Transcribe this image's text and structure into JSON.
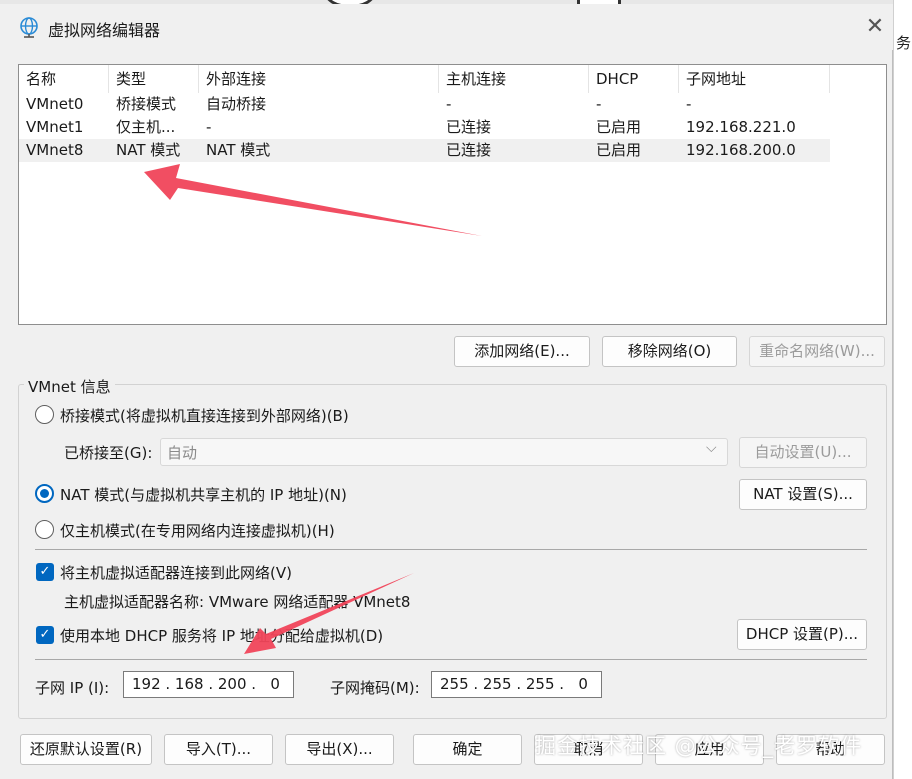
{
  "window": {
    "title": "虚拟网络编辑器",
    "close_glyph": "✕"
  },
  "background": {
    "right_text": "务"
  },
  "network_list": {
    "columns": [
      "名称",
      "类型",
      "外部连接",
      "主机连接",
      "DHCP",
      "子网地址"
    ],
    "rows": [
      {
        "name": "VMnet0",
        "type": "桥接模式",
        "external": "自动桥接",
        "host": "-",
        "dhcp": "-",
        "subnet": "-"
      },
      {
        "name": "VMnet1",
        "type": "仅主机...",
        "external": "-",
        "host": "已连接",
        "dhcp": "已启用",
        "subnet": "192.168.221.0"
      },
      {
        "name": "VMnet8",
        "type": "NAT 模式",
        "external": "NAT 模式",
        "host": "已连接",
        "dhcp": "已启用",
        "subnet": "192.168.200.0"
      }
    ],
    "selected_row": "VMnet8"
  },
  "list_buttons": {
    "add": "添加网络(E)...",
    "remove": "移除网络(O)",
    "rename": "重命名网络(W)..."
  },
  "vmnet_info": {
    "group_label": "VMnet 信息",
    "bridged_option": "桥接模式(将虚拟机直接连接到外部网络)(B)",
    "bridged_to_label": "已桥接至(G):",
    "bridged_to_value": "自动",
    "auto_settings": "自动设置(U)...",
    "nat_option": "NAT 模式(与虚拟机共享主机的 IP 地址)(N)",
    "nat_settings": "NAT 设置(S)...",
    "hostonly_option": "仅主机模式(在专用网络内连接虚拟机)(H)",
    "connect_adapter": "将主机虚拟适配器连接到此网络(V)",
    "adapter_name": "主机虚拟适配器名称: VMware 网络适配器 VMnet8",
    "use_dhcp": "使用本地 DHCP 服务将 IP 地址分配给虚拟机(D)",
    "dhcp_settings": "DHCP 设置(P)...",
    "subnet_ip_label": "子网 IP (I):",
    "subnet_ip_value": "192 . 168 . 200 .   0",
    "subnet_mask_label": "子网掩码(M):",
    "subnet_mask_value": "255 . 255 . 255 .   0"
  },
  "bottom_buttons": {
    "restore": "还原默认设置(R)",
    "import": "导入(T)...",
    "export": "导出(X)...",
    "ok": "确定",
    "cancel": "取消",
    "apply": "应用",
    "help": "帮助"
  },
  "watermark": "掘金技术社区 @公众号_老罗软件",
  "colors": {
    "accent": "#0067c0",
    "arrow": "#f0455a"
  }
}
